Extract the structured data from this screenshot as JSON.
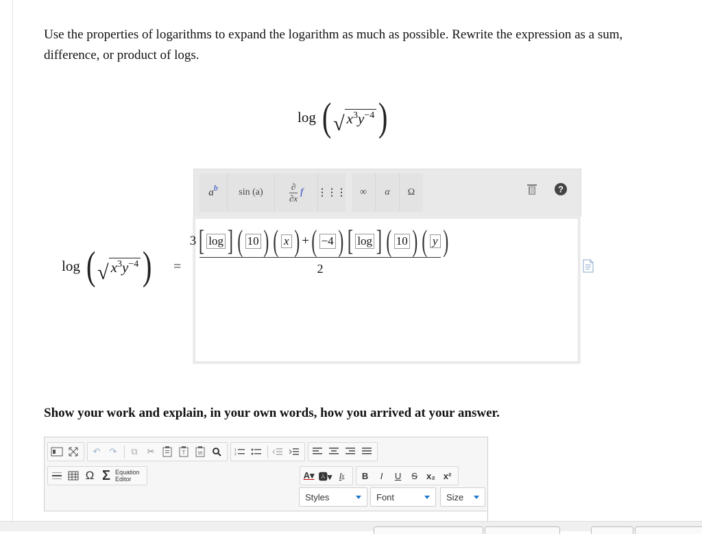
{
  "question": {
    "text": "Use the properties of logarithms to expand the logarithm as much as possible. Rewrite the expression as a sum, difference, or product of logs."
  },
  "expression": {
    "log": "log",
    "base_x": "x",
    "exp_x": "3",
    "base_y": "y",
    "exp_y": "−4"
  },
  "equals": "=",
  "math_toolbar": {
    "power_label": "a",
    "power_sup": "b",
    "trig_label": "sin (a)",
    "deriv_top": "∂",
    "deriv_bottom": "∂x",
    "deriv_f": "f",
    "matrix_glyph": "⋮⋮⋮",
    "infinity_glyph": "∞",
    "alpha_glyph": "α",
    "omega_glyph": "Ω"
  },
  "answer": {
    "coef": "3",
    "log1": "log",
    "ten1": "10",
    "x": "x",
    "plus": "+",
    "neg4": "−4",
    "log2": "log",
    "ten2": "10",
    "y": "y",
    "denominator": "2"
  },
  "prompt2": "Show your work and explain, in your own words, how you arrived at your answer.",
  "editor": {
    "equation_editor_line1": "Equation",
    "equation_editor_line2": "Editor",
    "bold": "B",
    "italic": "I",
    "underline": "U",
    "strike": "S",
    "sub": "x₂",
    "sup": "x²",
    "styles_label": "Styles",
    "font_label": "Font",
    "size_label": "Size"
  },
  "colors": {
    "accent_blue": "#1a73c8",
    "power_letter_b": "#1f3bbf",
    "help_dark": "#444444"
  }
}
